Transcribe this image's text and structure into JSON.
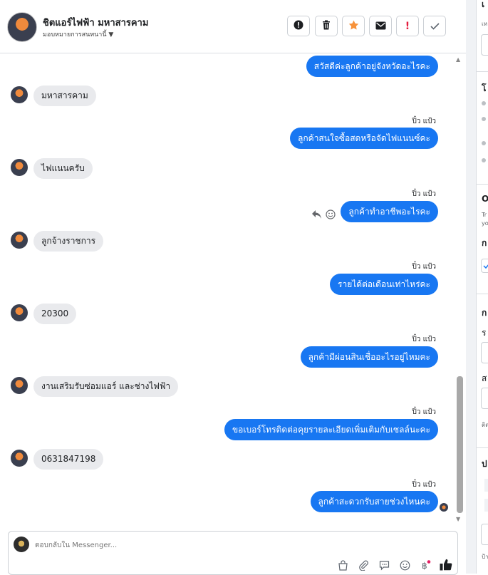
{
  "header": {
    "title": "ชิตแอร์ไฟฟ้า มหาสารคาม",
    "assign_label": "มอบหมายการสนทนานี้",
    "toolbar": {
      "icons": [
        "alert-circle-icon",
        "trash-icon",
        "star-icon",
        "envelope-icon",
        "exclamation-icon",
        "check-icon"
      ],
      "star_color": "#f7923a",
      "alert_color": "#e41e3f"
    }
  },
  "chat": {
    "messages": [
      {
        "side": "out",
        "text": "สวัสดีค่ะลูกค้าอยู่จังหวัดอะไรคะ"
      },
      {
        "side": "in",
        "text": "มหาสารคาม"
      },
      {
        "side": "out",
        "sender": "ปิ๋ว แป้ว",
        "text": "ลูกค้าสนใจซื้อสดหรือจัดไฟแนนซ์คะ"
      },
      {
        "side": "in",
        "text": "ไฟแนนครับ"
      },
      {
        "side": "out",
        "sender": "ปิ๋ว แป้ว",
        "text": "ลูกค้าทำอาชีพอะไรคะ"
      },
      {
        "side": "in",
        "text": "ลูกจ้างราชการ"
      },
      {
        "side": "out",
        "sender": "ปิ๋ว แป้ว",
        "text": "รายได้ต่อเดือนเท่าไหร่คะ"
      },
      {
        "side": "in",
        "text": "20300"
      },
      {
        "side": "out",
        "sender": "ปิ๋ว แป้ว",
        "text": "ลูกค้ามีผ่อนสินเชื่ออะไรอยู่ไหมคะ"
      },
      {
        "side": "in",
        "text": "งานเสริมรับซ่อมแอร์ และช่างไฟฟ้า"
      },
      {
        "side": "out",
        "sender": "ปิ๋ว แป้ว",
        "text": "ขอเบอร์โทรติดต่อคุยรายละเอียดเพิ่มเติมกับเซลล์นะคะ"
      },
      {
        "side": "in",
        "text": "0631847198"
      },
      {
        "side": "out",
        "sender": "ปิ๋ว แป้ว",
        "text": "ลูกค้าสะดวกรับสายช่วงไหนคะ"
      }
    ]
  },
  "reply": {
    "placeholder": "ตอบกลับใน Messenger..."
  },
  "right_panel": {
    "labels": [
      "เ",
      "โ",
      "O",
      "ก",
      "ก",
      "ร",
      "ส",
      "ป"
    ],
    "small_labels": [
      "เห",
      "Tr",
      "yo",
      "ติด",
      "ป้า"
    ]
  },
  "colors": {
    "accent": "#1877f2",
    "incoming_bubble": "#e9eaed"
  }
}
